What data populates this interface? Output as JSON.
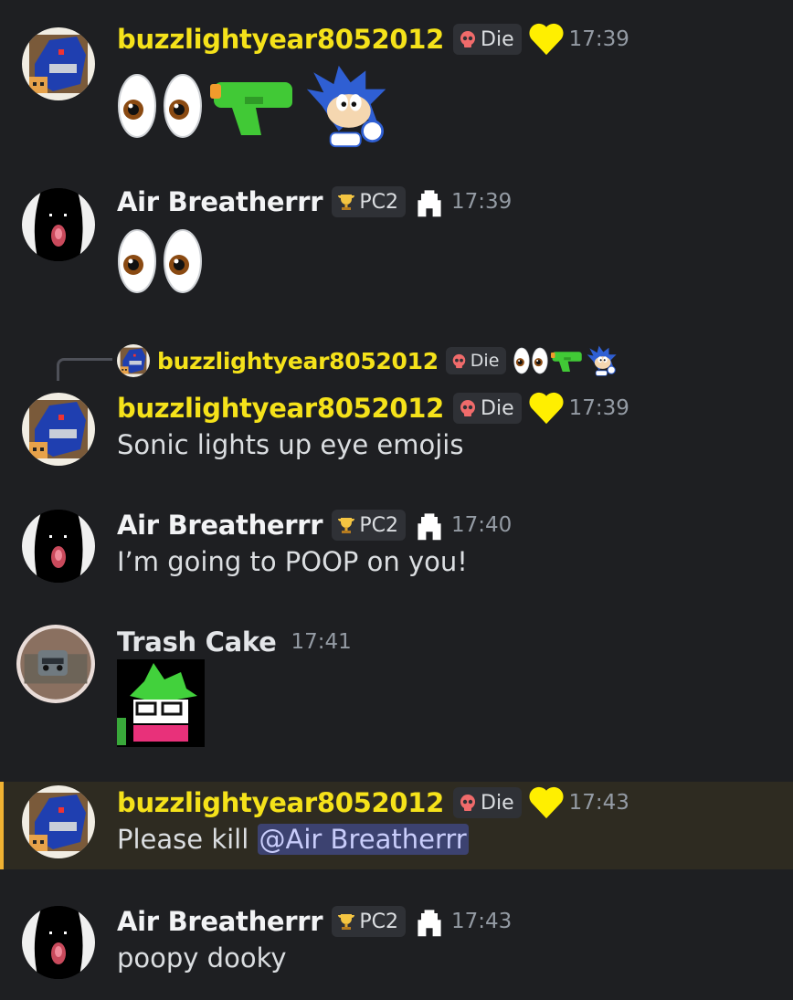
{
  "messages": [
    {
      "user": "buzzlightyear8052012",
      "tag": "Die",
      "time": "17:39",
      "content_emojis": [
        "eyes-emoji",
        "eyes-emoji",
        "water-pistol-emoji",
        "sonic-sticker-emoji"
      ]
    },
    {
      "user": "Air Breatherrr",
      "tag": "PC2",
      "time": "17:39",
      "content_emojis": [
        "eyes-emoji",
        "eyes-emoji"
      ]
    },
    {
      "reply": {
        "user": "buzzlightyear8052012",
        "tag": "Die",
        "preview_emojis": [
          "eyes-emoji",
          "eyes-emoji",
          "water-pistol-emoji",
          "sonic-sticker-emoji"
        ]
      },
      "user": "buzzlightyear8052012",
      "tag": "Die",
      "time": "17:39",
      "text": "Sonic lights up eye emojis"
    },
    {
      "user": "Air Breatherrr",
      "tag": "PC2",
      "time": "17:40",
      "text": "I’m going to POOP on you!"
    },
    {
      "user": "Trash Cake",
      "time": "17:41",
      "content_emojis": [
        "ralsei-sticker"
      ]
    },
    {
      "user": "buzzlightyear8052012",
      "tag": "Die",
      "time": "17:43",
      "text_prefix": "Please kill ",
      "mention": "@Air Breatherrr",
      "highlighted": true
    },
    {
      "user": "Air Breatherrr",
      "tag": "PC2",
      "time": "17:43",
      "text": "poopy dooky"
    }
  ],
  "colors": {
    "background": "#1e1f22",
    "buzz_name": "#f5e21a",
    "highlight_bar": "#f0b232",
    "mention_bg": "#3c4270"
  }
}
